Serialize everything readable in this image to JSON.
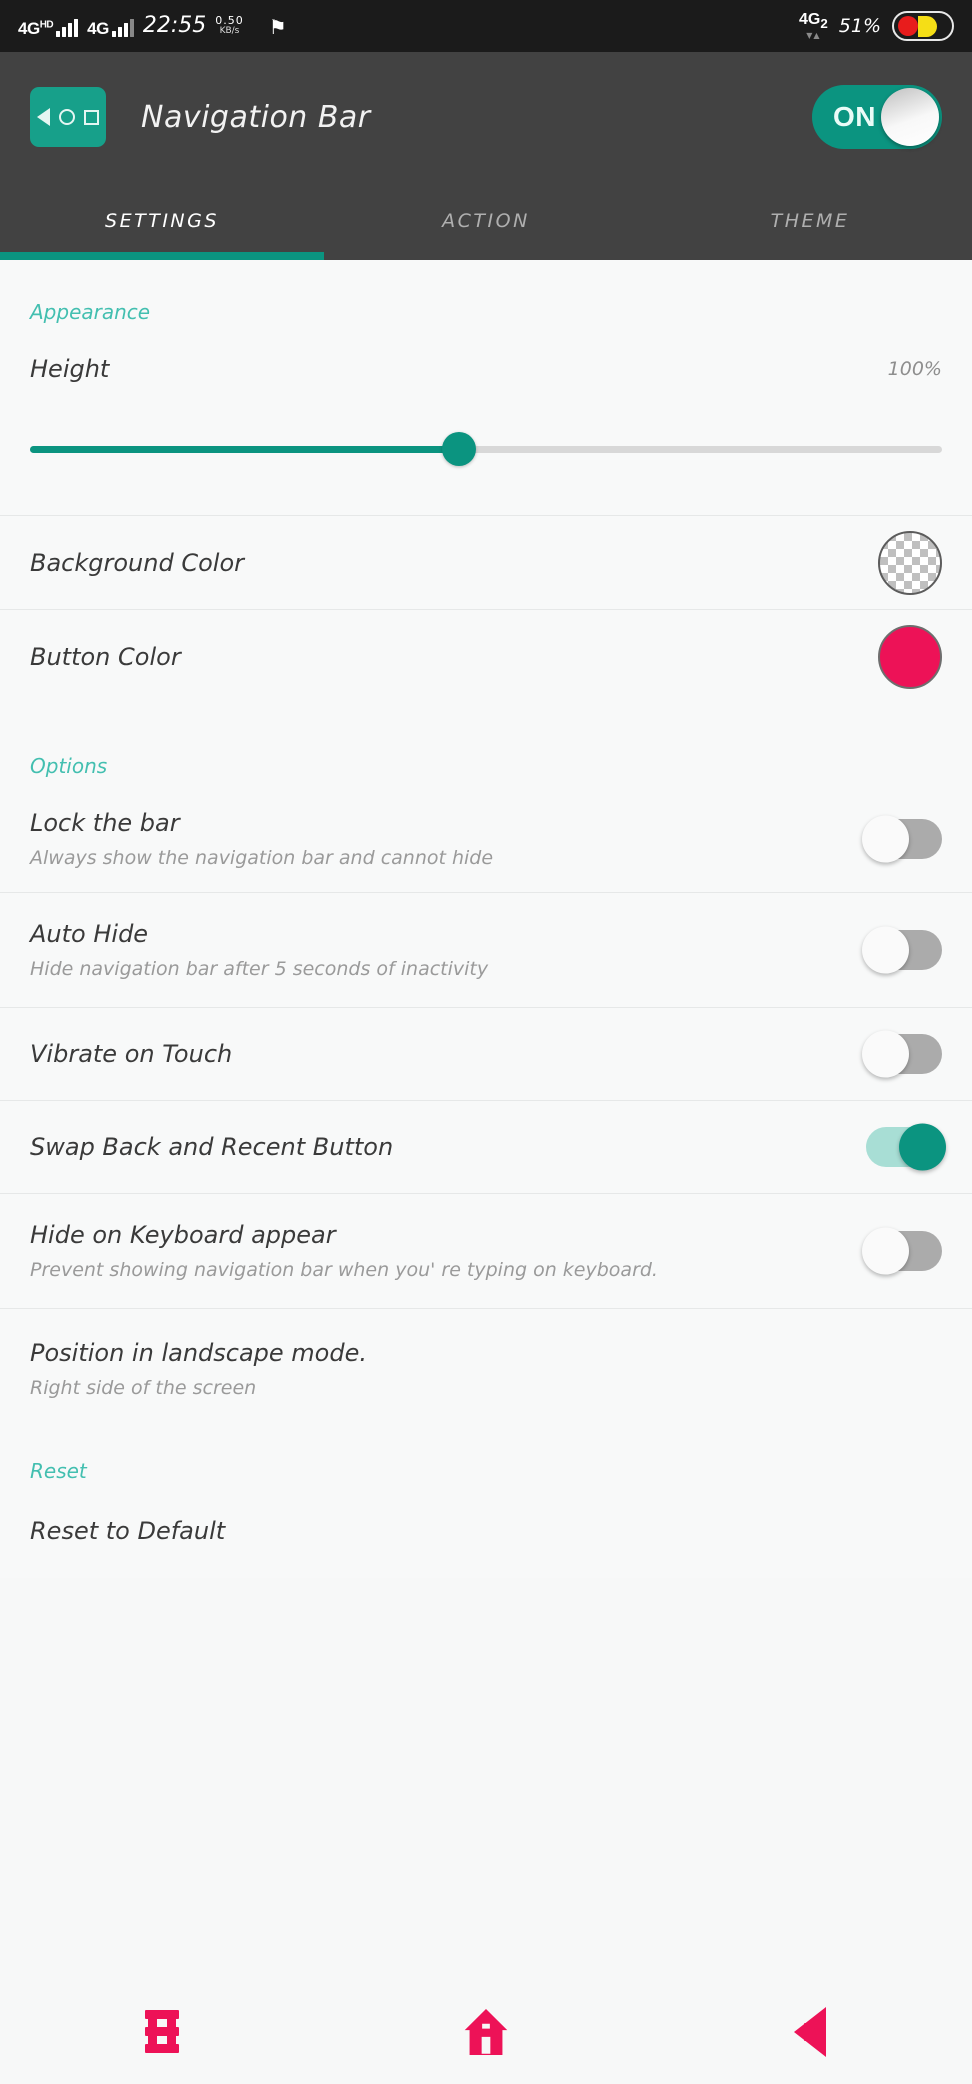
{
  "status_bar": {
    "network_primary": "4G",
    "network_primary_sup": "HD",
    "network_secondary": "4G",
    "time": "22:55",
    "speed_value": "0.50",
    "speed_unit": "KB/s",
    "flag_icon": "flag-check-icon",
    "network_right": "4G",
    "network_right_sub": "2",
    "battery_percent": "51%"
  },
  "app_bar": {
    "icon": "navigation-bar-app-icon",
    "title": "Navigation Bar",
    "master_toggle_label": "ON",
    "master_toggle_state": "on"
  },
  "tabs": {
    "items": [
      {
        "label": "SETTINGS",
        "active": true
      },
      {
        "label": "ACTION",
        "active": false
      },
      {
        "label": "THEME",
        "active": false
      }
    ]
  },
  "sections": {
    "appearance": {
      "header": "Appearance",
      "height": {
        "title": "Height",
        "value": "100%",
        "slider_percent": 47
      },
      "background_color": {
        "title": "Background Color",
        "swatch": "transparent-checker"
      },
      "button_color": {
        "title": "Button Color",
        "swatch_color": "#ED1257"
      }
    },
    "options": {
      "header": "Options",
      "items": [
        {
          "title": "Lock the bar",
          "subtitle": "Always show the navigation bar and cannot hide",
          "state": "off"
        },
        {
          "title": "Auto Hide",
          "subtitle": "Hide navigation bar after 5 seconds of inactivity",
          "state": "off"
        },
        {
          "title": "Vibrate on Touch",
          "subtitle": "",
          "state": "off"
        },
        {
          "title": "Swap Back and Recent Button",
          "subtitle": "",
          "state": "on"
        },
        {
          "title": "Hide on Keyboard appear",
          "subtitle": "Prevent showing navigation bar when you' re typing on keyboard.",
          "state": "off"
        },
        {
          "title": "Position in landscape mode.",
          "subtitle": "Right side of the screen",
          "state": "none"
        }
      ]
    },
    "reset": {
      "header": "Reset",
      "item_title": "Reset to Default"
    }
  },
  "nav_overlay": {
    "buttons": [
      {
        "icon": "recent-apps-icon"
      },
      {
        "icon": "home-icon"
      },
      {
        "icon": "back-icon"
      }
    ],
    "color": "#ED1257"
  },
  "colors": {
    "accent_teal": "#0B9480",
    "section_header": "#43BFB0",
    "pink": "#ED1257"
  }
}
